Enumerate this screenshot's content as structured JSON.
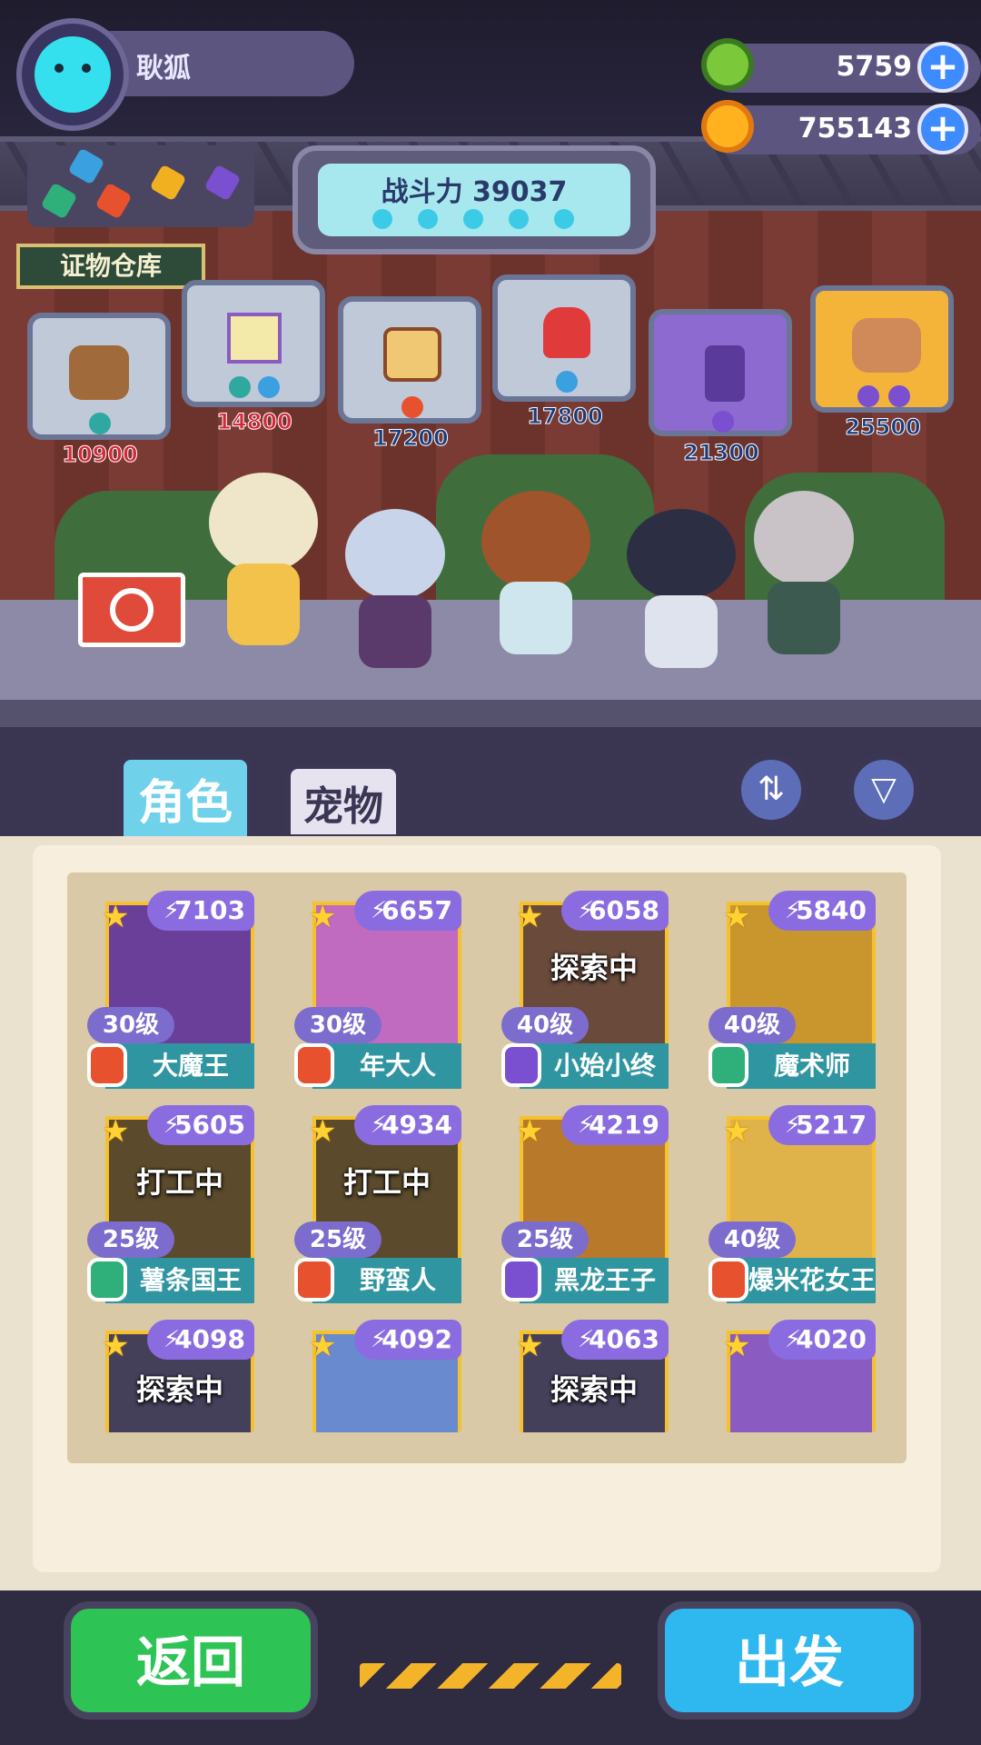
{
  "player": {
    "name": "耿狐"
  },
  "currencies": [
    {
      "icon": "green-donut-coin-icon",
      "value": "5759"
    },
    {
      "icon": "gold-planet-coin-icon",
      "value": "755143"
    }
  ],
  "power": {
    "label": "战斗力 39037"
  },
  "evidence": {
    "title": "证物仓库",
    "items": [
      {
        "value": "10900",
        "icon": "cat-pudding-icon"
      },
      {
        "value": "14800",
        "icon": "butterfly-stamp-icon"
      },
      {
        "value": "17200",
        "icon": "bread-frame-icon"
      },
      {
        "value": "17800",
        "icon": "red-helmet-icon"
      },
      {
        "value": "21300",
        "icon": "juice-bottle-icon"
      },
      {
        "value": "25500",
        "icon": "dog-face-icon"
      }
    ]
  },
  "tabs": {
    "roles": "角色",
    "pets": "宠物"
  },
  "characters": [
    {
      "power": "7103",
      "level": "30级",
      "name": "大魔王",
      "status": "",
      "role_color": "#e8512e",
      "art": "#6a3f9a"
    },
    {
      "power": "6657",
      "level": "30级",
      "name": "年大人",
      "status": "",
      "role_color": "#e8512e",
      "art": "#c06ac0"
    },
    {
      "power": "6058",
      "level": "40级",
      "name": "小始小终",
      "status": "探索中",
      "role_color": "#7a4fd0",
      "art": "#6a4a3a"
    },
    {
      "power": "5840",
      "level": "40级",
      "name": "魔术师",
      "status": "",
      "role_color": "#2fb07a",
      "art": "#c9962e"
    },
    {
      "power": "5605",
      "level": "25级",
      "name": "薯条国王",
      "status": "打工中",
      "role_color": "#2fb07a",
      "art": "#5b4a2c"
    },
    {
      "power": "4934",
      "level": "25级",
      "name": "野蛮人",
      "status": "打工中",
      "role_color": "#e8512e",
      "art": "#5b4a2c"
    },
    {
      "power": "4219",
      "level": "25级",
      "name": "黑龙王子",
      "status": "",
      "role_color": "#7a4fd0",
      "art": "#b9792a"
    },
    {
      "power": "5217",
      "level": "40级",
      "name": "爆米花女王",
      "status": "",
      "role_color": "#e8512e",
      "art": "#e0b24a"
    },
    {
      "power": "4098",
      "level": "",
      "name": "",
      "status": "探索中",
      "role_color": "#7a4fd0",
      "art": "#45405a"
    },
    {
      "power": "4092",
      "level": "",
      "name": "",
      "status": "",
      "role_color": "#7a4fd0",
      "art": "#6a8ad0"
    },
    {
      "power": "4063",
      "level": "",
      "name": "",
      "status": "探索中",
      "role_color": "#7a4fd0",
      "art": "#45405a"
    },
    {
      "power": "4020",
      "level": "",
      "name": "",
      "status": "",
      "role_color": "#7a4fd0",
      "art": "#8a5bc0"
    }
  ],
  "buttons": {
    "back": "返回",
    "go": "出发"
  }
}
